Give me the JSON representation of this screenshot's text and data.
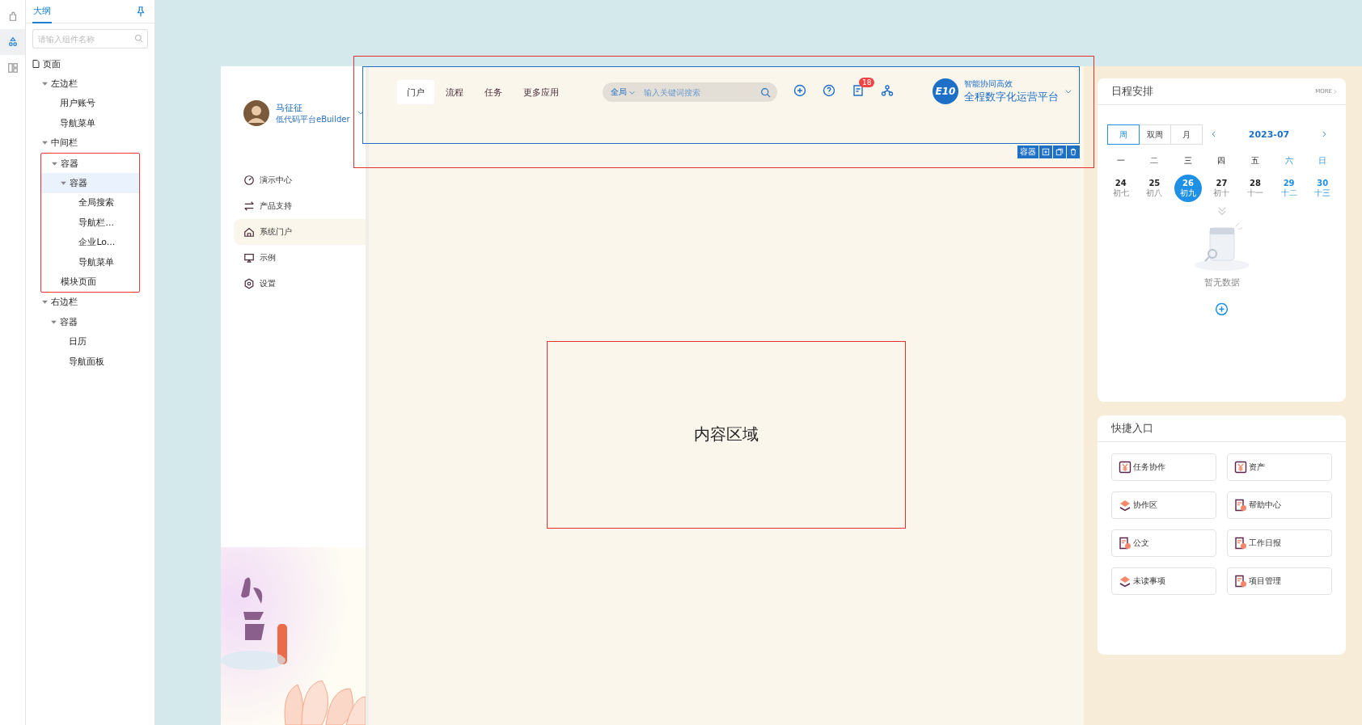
{
  "rail": [
    {
      "selected": false
    },
    {
      "selected": true
    },
    {
      "selected": false
    }
  ],
  "outline": {
    "tab": "大纲",
    "search": {
      "placeholder": "请输入组件名称"
    },
    "tree": [
      {
        "label": "页面",
        "kind": "page",
        "selected": false,
        "children": [
          {
            "label": "左边栏",
            "expanded": true,
            "highlighted": false,
            "selected": false,
            "children": [
              {
                "label": "用户账号",
                "selected": false
              },
              {
                "label": "导航菜单",
                "selected": false
              }
            ]
          },
          {
            "label": "中间栏",
            "expanded": true,
            "highlighted": true,
            "selected": false,
            "children": [
              {
                "label": "容器",
                "expanded": true,
                "highlighted": false,
                "selected": false,
                "children": [
                  {
                    "label": "容器",
                    "expanded": true,
                    "highlighted": false,
                    "selected": true,
                    "children": [
                      {
                        "label": "全局搜索",
                        "selected": false
                      },
                      {
                        "label": "导航栏...",
                        "selected": false
                      },
                      {
                        "label": "企业Lo...",
                        "selected": false
                      },
                      {
                        "label": "导航菜单",
                        "selected": false
                      }
                    ]
                  }
                ]
              },
              {
                "label": "模块页面",
                "selected": false
              }
            ]
          },
          {
            "label": "右边栏",
            "expanded": true,
            "highlighted": false,
            "selected": false,
            "children": [
              {
                "label": "容器",
                "expanded": true,
                "highlighted": false,
                "selected": false,
                "children": [
                  {
                    "label": "日历",
                    "selected": false
                  },
                  {
                    "label": "导航面板",
                    "selected": false
                  }
                ]
              }
            ]
          }
        ]
      }
    ]
  },
  "user": {
    "name": "马征征",
    "org": "低代码平台eBuilder"
  },
  "menu": [
    {
      "label": "演示中心",
      "selected": false
    },
    {
      "label": "产品支持",
      "selected": false
    },
    {
      "label": "系统门户",
      "selected": true
    },
    {
      "label": "示例",
      "selected": false
    },
    {
      "label": "设置",
      "selected": false
    }
  ],
  "header": {
    "hovered": true,
    "selected": true,
    "toolbar_label": "容器",
    "tabs": [
      {
        "label": "门户",
        "selected": true
      },
      {
        "label": "流程",
        "selected": false
      },
      {
        "label": "任务",
        "selected": false
      },
      {
        "label": "更多应用",
        "selected": false
      }
    ],
    "search": {
      "scope": "全局",
      "placeholder": "输入关键词搜索"
    },
    "actions": [
      {
        "kind": "add"
      },
      {
        "kind": "help"
      },
      {
        "kind": "message",
        "badge": "18"
      },
      {
        "kind": "org"
      }
    ],
    "brand": {
      "logo": "E10",
      "slogan": "智能协同高效",
      "title": "全程数字化运营平台"
    }
  },
  "content": {
    "label": "内容区域",
    "hovered": true
  },
  "schedule": {
    "title": "日程安排",
    "more": "MORE",
    "views": [
      {
        "label": "周",
        "selected": true
      },
      {
        "label": "双周",
        "selected": false
      },
      {
        "label": "月",
        "selected": false
      }
    ],
    "month": "2023-07",
    "weekdays": [
      {
        "label": "一",
        "weekend": false
      },
      {
        "label": "二",
        "weekend": false
      },
      {
        "label": "三",
        "weekend": false
      },
      {
        "label": "四",
        "weekend": false
      },
      {
        "label": "五",
        "weekend": false
      },
      {
        "label": "六",
        "weekend": true
      },
      {
        "label": "日",
        "weekend": true
      }
    ],
    "days": [
      {
        "day": "24",
        "lunar": "初七",
        "weekend": false,
        "selected": false
      },
      {
        "day": "25",
        "lunar": "初八",
        "weekend": false,
        "selected": false
      },
      {
        "day": "26",
        "lunar": "初九",
        "weekend": false,
        "selected": true
      },
      {
        "day": "27",
        "lunar": "初十",
        "weekend": false,
        "selected": false
      },
      {
        "day": "28",
        "lunar": "十一",
        "weekend": false,
        "selected": false
      },
      {
        "day": "29",
        "lunar": "十二",
        "weekend": true,
        "selected": false
      },
      {
        "day": "30",
        "lunar": "十三",
        "weekend": true,
        "selected": false
      }
    ],
    "empty": "暂无数据"
  },
  "quick": {
    "title": "快捷入口",
    "items": [
      {
        "label": "任务协作",
        "kind": "finance"
      },
      {
        "label": "资产",
        "kind": "finance"
      },
      {
        "label": "协作区",
        "kind": "layers"
      },
      {
        "label": "帮助中心",
        "kind": "report"
      },
      {
        "label": "公文",
        "kind": "report"
      },
      {
        "label": "工作日报",
        "kind": "report"
      },
      {
        "label": "未读事项",
        "kind": "layers"
      },
      {
        "label": "项目管理",
        "kind": "report"
      }
    ]
  }
}
